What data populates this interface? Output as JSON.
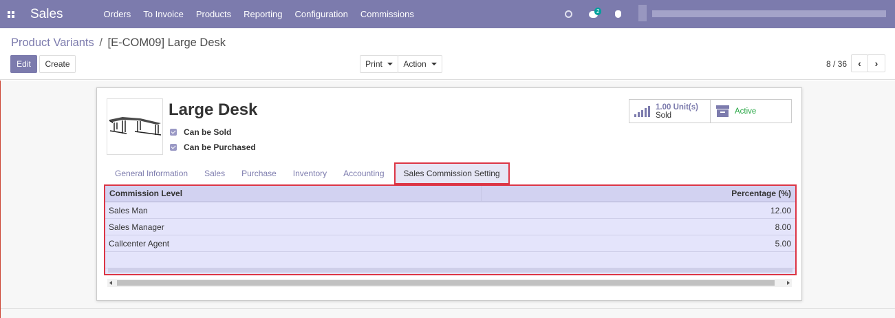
{
  "navbar": {
    "app_title": "Sales",
    "menu": [
      "Orders",
      "To Invoice",
      "Products",
      "Reporting",
      "Configuration",
      "Commissions"
    ],
    "message_count": "2"
  },
  "breadcrumb": {
    "parent": "Product Variants",
    "separator": "/",
    "current": "[E-COM09] Large Desk"
  },
  "buttons": {
    "edit": "Edit",
    "create": "Create",
    "print": "Print",
    "action": "Action"
  },
  "pager": {
    "value": "8 / 36",
    "prev": "‹",
    "next": "›"
  },
  "product": {
    "name": "Large Desk",
    "can_be_sold": "Can be Sold",
    "can_be_purchased": "Can be Purchased"
  },
  "stats": {
    "sold_value": "1.00 Unit(s)",
    "sold_label": "Sold",
    "active_label": "Active"
  },
  "tabs": [
    "General Information",
    "Sales",
    "Purchase",
    "Inventory",
    "Accounting",
    "Sales Commission Setting"
  ],
  "commission_table": {
    "headers": [
      "Commission Level",
      "Percentage (%)"
    ],
    "rows": [
      {
        "level": "Sales Man",
        "percentage": "12.00"
      },
      {
        "level": "Sales Manager",
        "percentage": "8.00"
      },
      {
        "level": "Callcenter Agent",
        "percentage": "5.00"
      }
    ]
  },
  "colors": {
    "brand": "#7c7bad",
    "highlight_border": "#dc3545",
    "active_status": "#28a745"
  }
}
